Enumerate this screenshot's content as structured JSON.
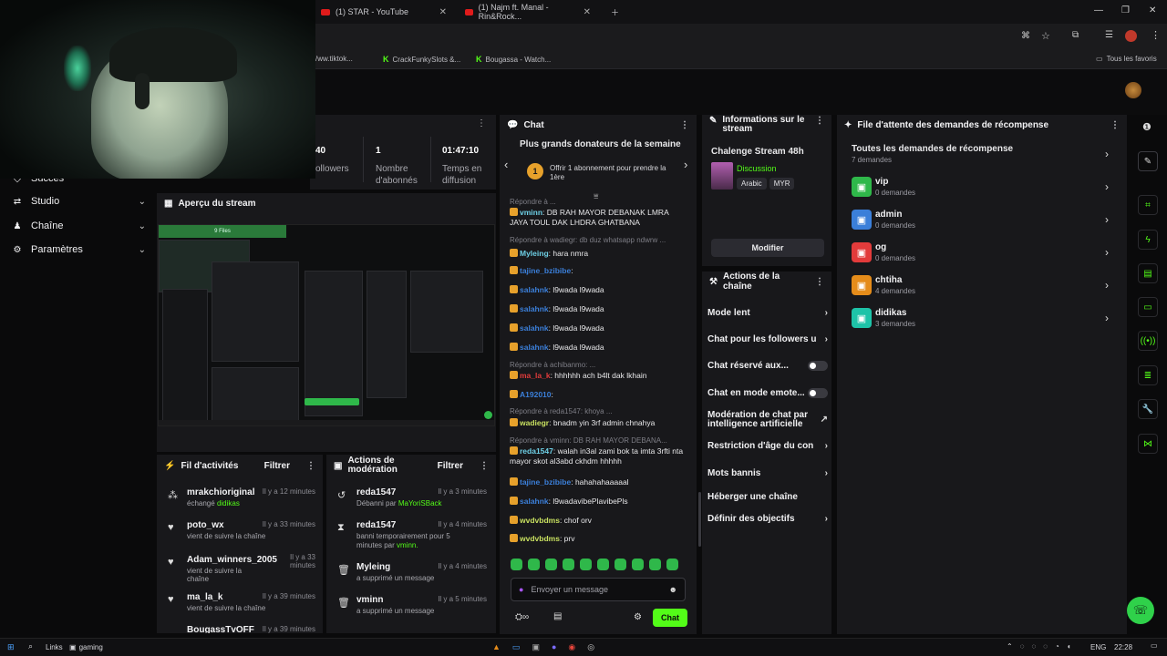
{
  "browser": {
    "tabs": [
      {
        "label": "(1) STAR - YouTube"
      },
      {
        "label": "(1) Najm ft. Manal - Rin&Rock..."
      }
    ],
    "bookmarks": [
      {
        "label": "/ww.tiktok..."
      },
      {
        "label": "CrackFunkySlots &..."
      },
      {
        "label": "Bougassa - Watch..."
      },
      {
        "label": "Tous les favoris"
      }
    ]
  },
  "sidebar": {
    "items": [
      {
        "label": "Succès"
      },
      {
        "label": "Studio"
      },
      {
        "label": "Chaîne"
      },
      {
        "label": "Paramètres"
      }
    ]
  },
  "stats": {
    "items": [
      {
        "value": "40",
        "label": "ollowers"
      },
      {
        "value": "1",
        "label": "Nombre d'abonnés"
      },
      {
        "value": "01:47:10",
        "label": "Temps en diffusion"
      }
    ]
  },
  "preview": {
    "title": "Aperçu du stream",
    "inner_label": "9 Files"
  },
  "activity": {
    "title": "Fil d'activités",
    "filter": "Filtrer",
    "rows": [
      {
        "name": "mrakchioriginal",
        "sub": "échangé",
        "sub_highlight": "didikas",
        "time": "Il y a 12 minutes"
      },
      {
        "name": "poto_wx",
        "sub": "vient de suivre la chaîne",
        "sub_highlight": "",
        "time": "Il y a 33 minutes"
      },
      {
        "name": "Adam_winners_2005",
        "sub": "vient de suivre la chaîne",
        "sub_highlight": "",
        "time": "Il y a 33 minutes"
      },
      {
        "name": "ma_la_k",
        "sub": "vient de suivre la chaîne",
        "sub_highlight": "",
        "time": "Il y a 39 minutes"
      },
      {
        "name": "BougassTvOFF",
        "sub": "",
        "sub_highlight": "",
        "time": "Il y a 39 minutes"
      }
    ]
  },
  "moderation": {
    "title": "Actions de modération",
    "filter": "Filtrer",
    "rows": [
      {
        "name": "reda1547",
        "sub": "Débanni par",
        "sub_highlight": "MaYoriSBack",
        "time": "Il y a 3 minutes"
      },
      {
        "name": "reda1547",
        "sub": "banni temporairement pour 5 minutes par",
        "sub_highlight": "vminn.",
        "time": "Il y a 4 minutes"
      },
      {
        "name": "Myleing",
        "sub": "a supprimé un message",
        "sub_highlight": "",
        "time": "Il y a 4 minutes"
      },
      {
        "name": "vminn",
        "sub": "a supprimé un message",
        "sub_highlight": "",
        "time": "Il y a 5 minutes"
      }
    ]
  },
  "chat": {
    "title": "Chat",
    "donors_title": "Plus grands donateurs de la semaine",
    "donor_rank": "1",
    "donor_text": "Offrir 1 abonnement pour prendre la 1ère",
    "lines": [
      {
        "kind": "reply",
        "text": "Répondre à ..."
      },
      {
        "kind": "msg",
        "user": "vminn",
        "color": "#6ed0e6",
        "text": "DB RAH MAYOR DEBANAK LMRA JAYA TOUL DAK LHDRA GHATBANA"
      },
      {
        "kind": "reply",
        "text": "Répondre à wadiegr: db duz whatsapp ndwrw ..."
      },
      {
        "kind": "msg",
        "user": "Myleing",
        "color": "#6ed0e6",
        "text": "hara nmra"
      },
      {
        "kind": "msg",
        "user": "tajine_bzibibe",
        "color": "#3b7fd9",
        "text": ""
      },
      {
        "kind": "msg",
        "user": "salahnk",
        "color": "#3b7fd9",
        "text": "l9wada l9wada"
      },
      {
        "kind": "msg",
        "user": "salahnk",
        "color": "#3b7fd9",
        "text": "l9wada l9wada"
      },
      {
        "kind": "msg",
        "user": "salahnk",
        "color": "#3b7fd9",
        "text": "l9wada l9wada"
      },
      {
        "kind": "msg",
        "user": "salahnk",
        "color": "#3b7fd9",
        "text": "l9wada l9wada"
      },
      {
        "kind": "reply",
        "text": "Répondre à achibanmo: ..."
      },
      {
        "kind": "msg",
        "user": "ma_la_k",
        "color": "#e23b3b",
        "text": "hhhhhh ach b4lt dak lkhain"
      },
      {
        "kind": "msg",
        "user": "A192010",
        "color": "#3b7fd9",
        "text": ""
      },
      {
        "kind": "reply",
        "text": "Répondre à reda1547: khoya ..."
      },
      {
        "kind": "msg",
        "user": "wadiegr",
        "color": "#c8e060",
        "text": "bnadm yin 3rf admin chnahya"
      },
      {
        "kind": "reply",
        "text": "Répondre à vminn: DB RAH MAYOR DEBANA..."
      },
      {
        "kind": "msg",
        "user": "reda1547",
        "color": "#6ed0e6",
        "text": "walah in3al zami bok ta imta 3rfti nta mayor skot al3abd ckhdm hhhhh"
      },
      {
        "kind": "msg",
        "user": "tajine_bzibibe",
        "color": "#3b7fd9",
        "text": "hahahahaaaaal"
      },
      {
        "kind": "msg",
        "user": "salahnk",
        "color": "#3b7fd9",
        "text": "l9wadavibePlavibePls"
      },
      {
        "kind": "msg",
        "user": "wvdvbdms",
        "color": "#c8e060",
        "text": "chof orv"
      },
      {
        "kind": "msg",
        "user": "wvdvbdms",
        "color": "#c8e060",
        "text": "prv"
      }
    ],
    "input_placeholder": "Envoyer un message",
    "send_label": "Chat"
  },
  "info": {
    "title": "Informations sur le stream",
    "stream_title": "Chalenge Stream 48h",
    "category": "Discussion",
    "tags": [
      "Arabic",
      "MYR"
    ],
    "modify": "Modifier"
  },
  "actions": {
    "title": "Actions de la chaîne",
    "rows": [
      {
        "label": "Mode lent",
        "control": "chevron"
      },
      {
        "label": "Chat pour les followers u",
        "control": "chevron"
      },
      {
        "label": "Chat réservé aux...",
        "control": "toggle"
      },
      {
        "label": "Chat en mode emote...",
        "control": "toggle"
      },
      {
        "label": "Modération de chat par intelligence artificielle",
        "control": "external"
      },
      {
        "label": "Restriction d'âge du con",
        "control": "chevron"
      },
      {
        "label": "Mots bannis",
        "control": "chevron"
      },
      {
        "label": "Héberger une chaîne",
        "control": "none"
      },
      {
        "label": "Définir des objectifs",
        "control": "chevron"
      }
    ]
  },
  "rewards": {
    "title": "File d'attente des demandes de récompense",
    "all_label": "Toutes les demandes de récompense",
    "all_count": "7 demandes",
    "items": [
      {
        "name": "vip",
        "count": "0 demandes",
        "color": "#2fb84a"
      },
      {
        "name": "admin",
        "count": "0 demandes",
        "color": "#3b7fd9"
      },
      {
        "name": "og",
        "count": "0 demandes",
        "color": "#e23b3b"
      },
      {
        "name": "chtiha",
        "count": "4 demandes",
        "color": "#e58c1a"
      },
      {
        "name": "didikas",
        "count": "3 demandes",
        "color": "#1ec3a8"
      }
    ]
  },
  "taskbar": {
    "links": "Links",
    "gaming": "gaming",
    "lang": "ENG",
    "time": "22:28"
  }
}
